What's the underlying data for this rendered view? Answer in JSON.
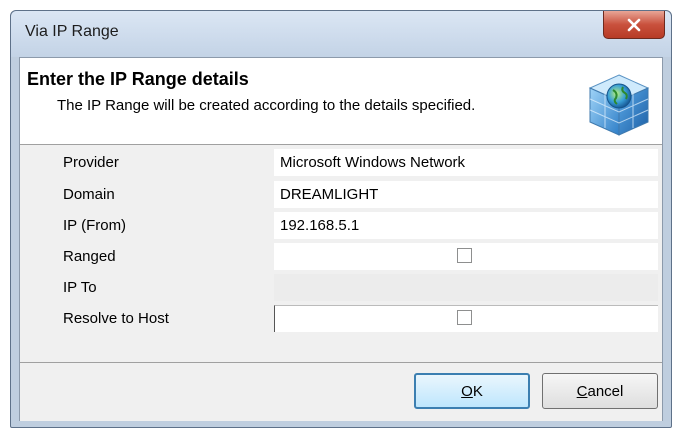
{
  "window": {
    "title": "Via IP Range",
    "close_label": "X"
  },
  "header": {
    "title": "Enter the IP Range details",
    "subtitle": "The IP Range will be created according to the details specified.",
    "icon": "network-globe-icon"
  },
  "form": {
    "rows": [
      {
        "label": "Provider",
        "value": "Microsoft Windows Network",
        "type": "text"
      },
      {
        "label": "Domain",
        "value": "DREAMLIGHT",
        "type": "text"
      },
      {
        "label": "IP (From)",
        "value": "192.168.5.1",
        "type": "text"
      },
      {
        "label": "Ranged",
        "checked": false,
        "type": "checkbox"
      },
      {
        "label": "IP To",
        "value": "",
        "type": "disabled"
      },
      {
        "label": "Resolve to Host",
        "checked": false,
        "type": "checkbox"
      }
    ]
  },
  "buttons": {
    "ok_mnemonic": "O",
    "ok_rest": "K",
    "cancel_mnemonic": "C",
    "cancel_rest": "ancel"
  },
  "colors": {
    "frame": "#bfcedf",
    "close": "#c9513d",
    "default_button_border": "#3c7fb1"
  }
}
